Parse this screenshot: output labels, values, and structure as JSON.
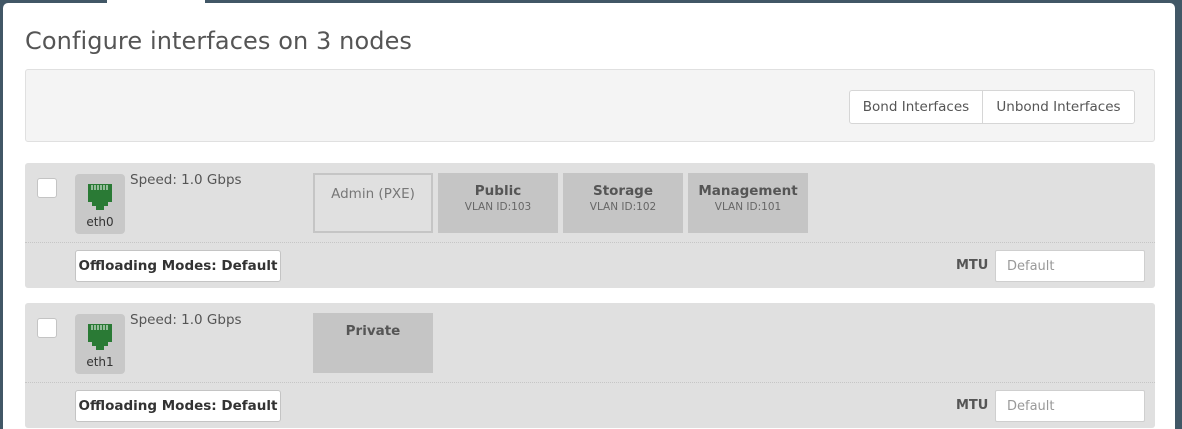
{
  "page": {
    "title": "Configure interfaces on 3 nodes"
  },
  "toolbar": {
    "bond_label": "Bond Interfaces",
    "unbond_label": "Unbond Interfaces"
  },
  "colors": {
    "background": "#415766",
    "panel": "#ffffff",
    "row": "#e0e0e0",
    "network_block": "#c5c5c5",
    "port_icon": "#2a7a35"
  },
  "interfaces": [
    {
      "name": "eth0",
      "icon": "ethernet-port-icon",
      "speed": "Speed: 1.0 Gbps",
      "networks": [
        {
          "name": "Admin (PXE)",
          "vlan": "",
          "style": "dashed"
        },
        {
          "name": "Public",
          "vlan": "VLAN ID:103",
          "style": "solid"
        },
        {
          "name": "Storage",
          "vlan": "VLAN ID:102",
          "style": "solid"
        },
        {
          "name": "Management",
          "vlan": "VLAN ID:101",
          "style": "solid"
        }
      ],
      "offloading_label": "Offloading Modes: Default",
      "mtu_label": "MTU",
      "mtu_placeholder": "Default"
    },
    {
      "name": "eth1",
      "icon": "ethernet-port-icon",
      "speed": "Speed: 1.0 Gbps",
      "networks": [
        {
          "name": "Private",
          "vlan": "",
          "style": "solid"
        }
      ],
      "offloading_label": "Offloading Modes: Default",
      "mtu_label": "MTU",
      "mtu_placeholder": "Default"
    }
  ]
}
